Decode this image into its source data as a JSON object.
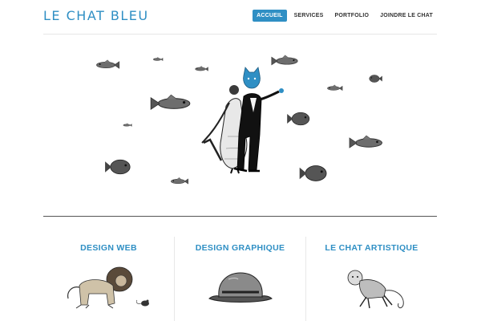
{
  "header": {
    "logo": "LE CHAT BLEU",
    "nav": [
      {
        "label": "ACCUEIL",
        "active": true
      },
      {
        "label": "SERVICES",
        "active": false
      },
      {
        "label": "PORTFOLIO",
        "active": false
      },
      {
        "label": "JOINDRE LE CHAT",
        "active": false
      }
    ]
  },
  "hero": {
    "image": "couple-dancing-with-fish-illustration",
    "icons": [
      "fish-icon",
      "dancing-couple-illustration",
      "cat-mask-icon"
    ]
  },
  "services": [
    {
      "title": "DESIGN WEB",
      "illustration": "lion-and-mouse-illustration"
    },
    {
      "title": "DESIGN GRAPHIQUE",
      "illustration": "bowler-hat-illustration"
    },
    {
      "title": "LE CHAT ARTISTIQUE",
      "illustration": "monkey-illustration"
    }
  ],
  "colors": {
    "accent": "#2f8fc4",
    "text": "#333333",
    "divider": "#555555"
  }
}
